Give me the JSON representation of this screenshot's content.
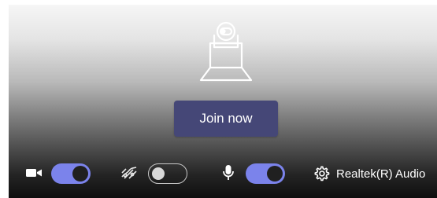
{
  "prejoin": {
    "join_label": "Join now"
  },
  "controls": {
    "camera": {
      "icon": "video-camera-icon",
      "toggle_state": "on"
    },
    "background_effects": {
      "icon": "background-blur-icon",
      "toggle_state": "off"
    },
    "microphone": {
      "icon": "microphone-icon",
      "toggle_state": "on"
    },
    "audio_device": {
      "icon": "gear-icon",
      "label": "Realtek(R) Audio"
    }
  },
  "colors": {
    "toggle_on": "#7b83eb",
    "join_button": "#454777",
    "controls_text": "#ffffff"
  }
}
